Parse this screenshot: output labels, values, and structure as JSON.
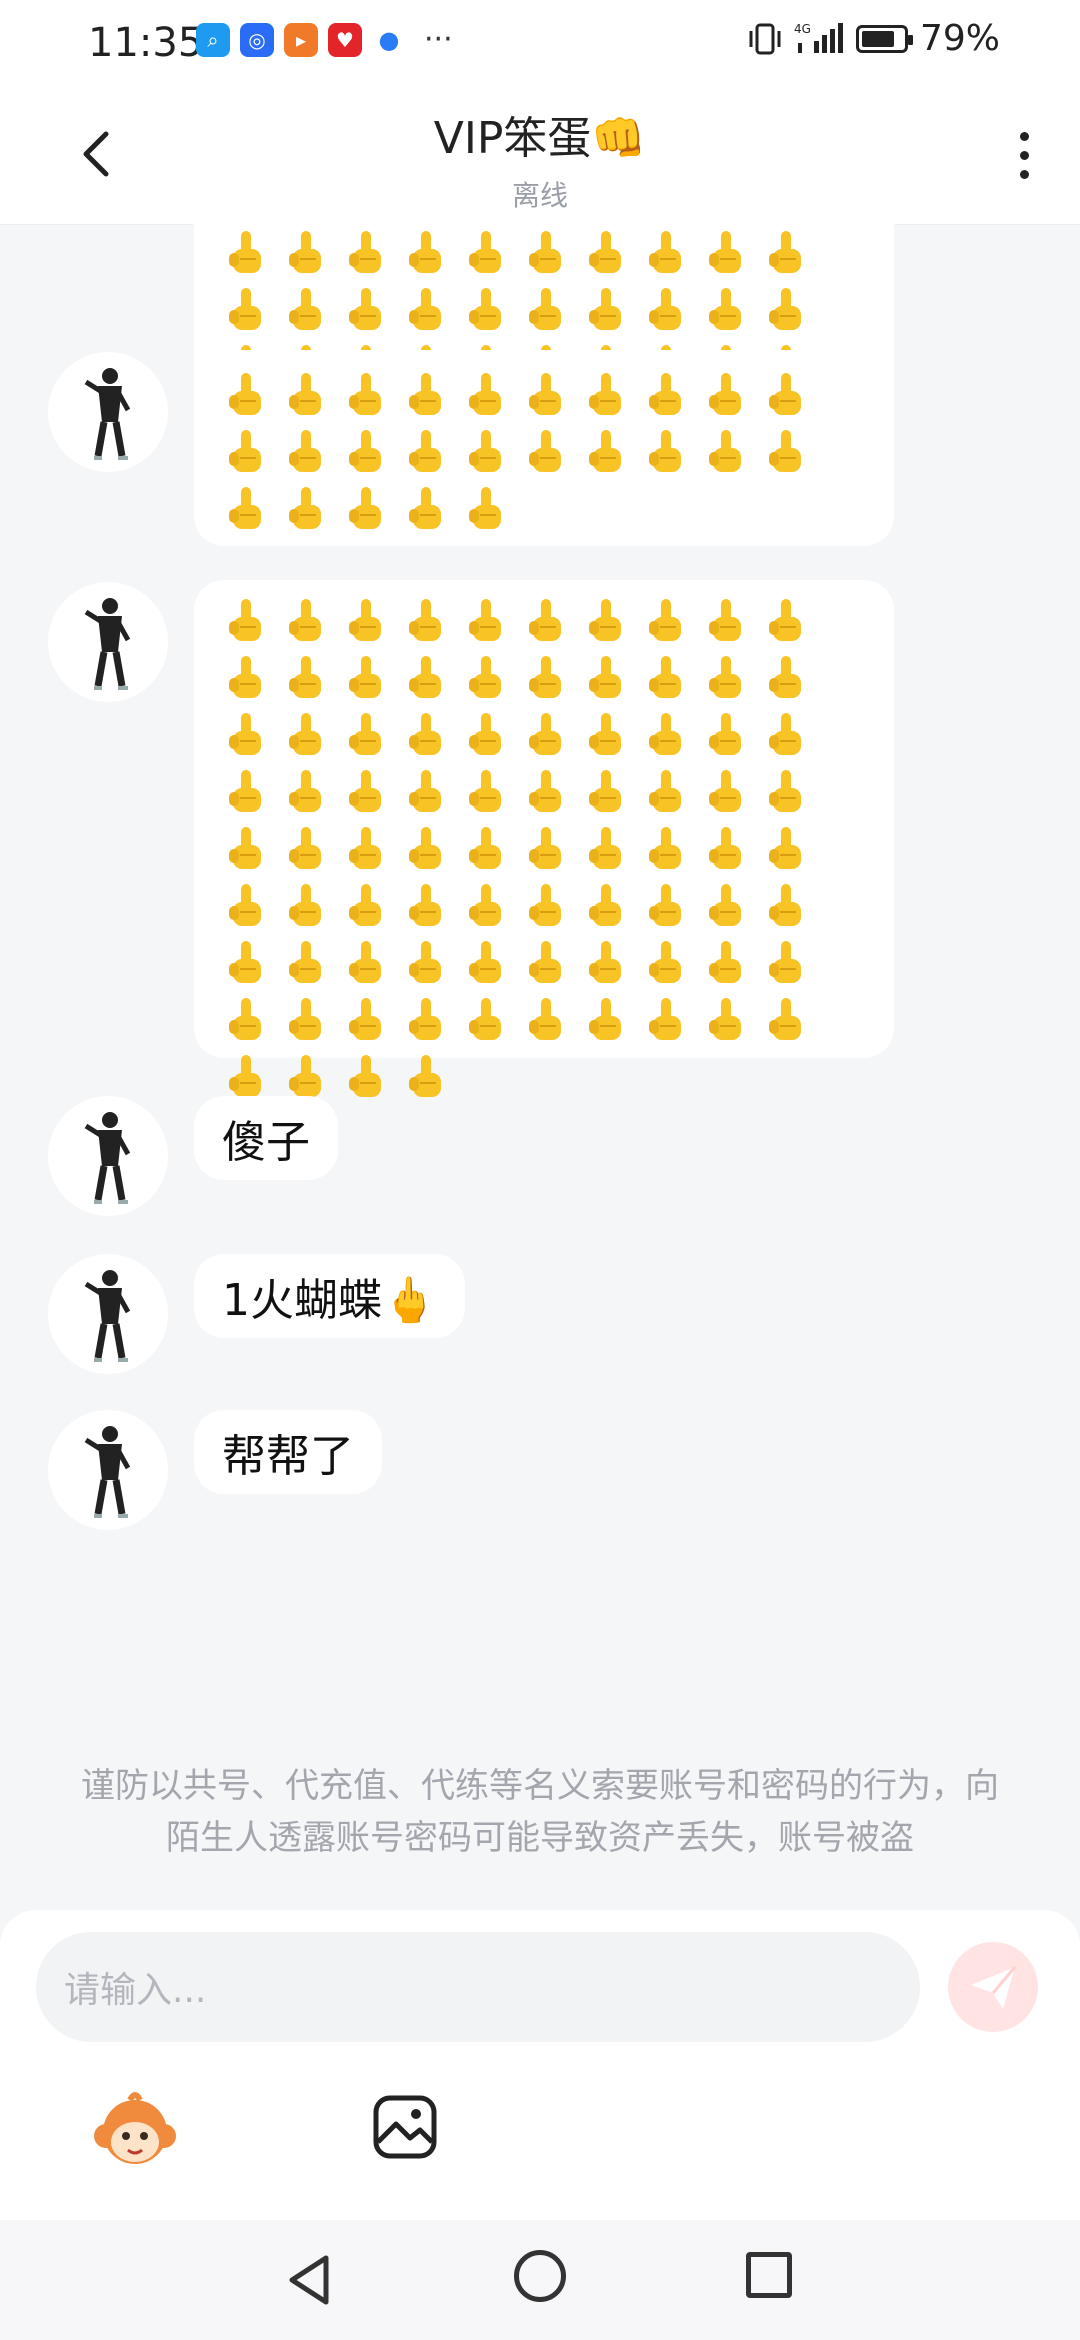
{
  "status_bar": {
    "time": "11:35",
    "network": "4G",
    "battery": "79%",
    "battery_level": 0.79
  },
  "header": {
    "title": "VIP笨蛋👊",
    "status": "离线"
  },
  "messages": [
    {
      "type": "emoji",
      "emoji": "🖕",
      "count": 50,
      "partial_top": true
    },
    {
      "type": "emoji",
      "emoji": "🖕",
      "count": 25
    },
    {
      "type": "emoji",
      "emoji": "🖕",
      "count": 84
    },
    {
      "type": "text",
      "text": "傻子"
    },
    {
      "type": "text",
      "text": "1火蝴蝶🖕"
    },
    {
      "type": "text",
      "text": "帮帮了"
    }
  ],
  "notice": "谨防以共号、代充值、代练等名义索要账号和密码的行为，向陌生人透露账号密码可能导致资产丢失，账号被盗",
  "input": {
    "placeholder": "请输入..."
  },
  "colors": {
    "accent": "#ff6f61",
    "background": "#f5f6f8",
    "emoji_yellow": "#f7c325"
  }
}
